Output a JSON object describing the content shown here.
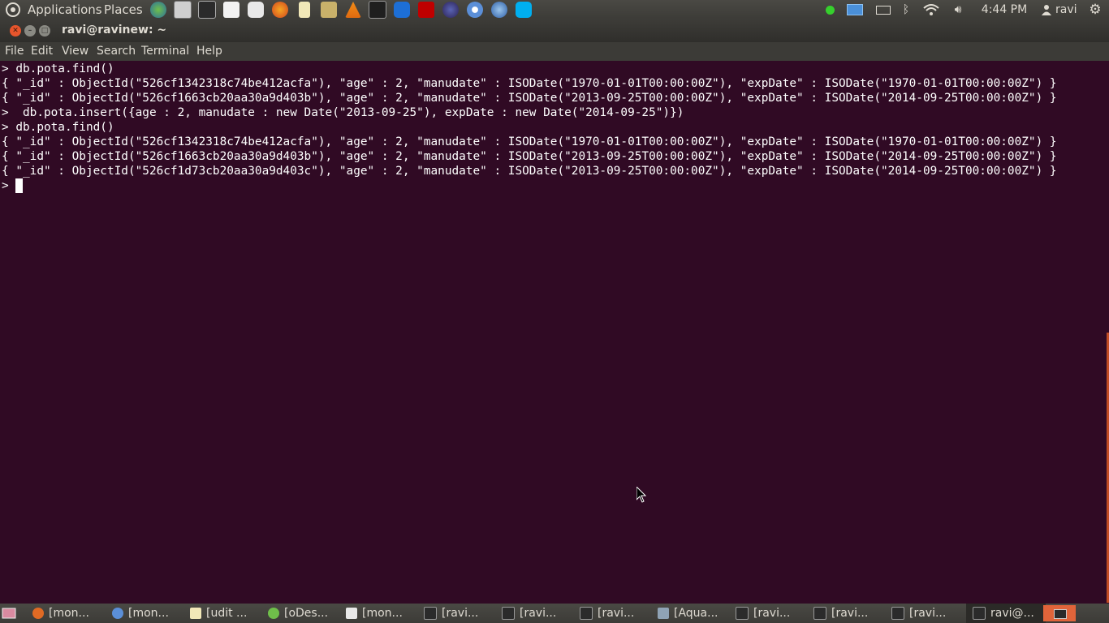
{
  "top_panel": {
    "applications": "Applications",
    "places": "Places",
    "launchers": [
      "globe-icon",
      "screenshot-icon",
      "terminal-icon",
      "text-editor-icon",
      "chat-icon",
      "firefox-icon",
      "notes-icon",
      "folder-icon",
      "vlc-icon",
      "system-monitor-icon",
      "teamviewer-icon",
      "filezilla-icon",
      "eclipse-icon",
      "chromium-icon",
      "thunderbird-icon",
      "skype-icon"
    ],
    "clock": "4:44 PM",
    "user": "ravi"
  },
  "window": {
    "title": "ravi@ravinew: ~"
  },
  "menubar": {
    "file": "File",
    "edit": "Edit",
    "view": "View",
    "search": "Search",
    "terminal": "Terminal",
    "help": "Help"
  },
  "terminal": {
    "lines": [
      "> db.pota.find()",
      "{ \"_id\" : ObjectId(\"526cf1342318c74be412acfa\"), \"age\" : 2, \"manudate\" : ISODate(\"1970-01-01T00:00:00Z\"), \"expDate\" : ISODate(\"1970-01-01T00:00:00Z\") }",
      "{ \"_id\" : ObjectId(\"526cf1663cb20aa30a9d403b\"), \"age\" : 2, \"manudate\" : ISODate(\"2013-09-25T00:00:00Z\"), \"expDate\" : ISODate(\"2014-09-25T00:00:00Z\") }",
      ">  db.pota.insert({age : 2, manudate : new Date(\"2013-09-25\"), expDate : new Date(\"2014-09-25\")})",
      "> db.pota.find()",
      "{ \"_id\" : ObjectId(\"526cf1342318c74be412acfa\"), \"age\" : 2, \"manudate\" : ISODate(\"1970-01-01T00:00:00Z\"), \"expDate\" : ISODate(\"1970-01-01T00:00:00Z\") }",
      "{ \"_id\" : ObjectId(\"526cf1663cb20aa30a9d403b\"), \"age\" : 2, \"manudate\" : ISODate(\"2013-09-25T00:00:00Z\"), \"expDate\" : ISODate(\"2014-09-25T00:00:00Z\") }",
      "{ \"_id\" : ObjectId(\"526cf1d73cb20aa30a9d403c\"), \"age\" : 2, \"manudate\" : ISODate(\"2013-09-25T00:00:00Z\"), \"expDate\" : ISODate(\"2014-09-25T00:00:00Z\") }",
      "> "
    ]
  },
  "taskbar": {
    "tasks": [
      "[mon...",
      "[mon...",
      "[udit ...",
      "[oDes...",
      "[mon...",
      "[ravi...",
      "[ravi...",
      "[ravi...",
      "[Aqua...",
      "[ravi...",
      "[ravi...",
      "[ravi...",
      "ravi@..."
    ]
  },
  "colors": {
    "terminal_bg": "#300a24",
    "panel": "#3c3b37",
    "accent": "#e0643a"
  }
}
